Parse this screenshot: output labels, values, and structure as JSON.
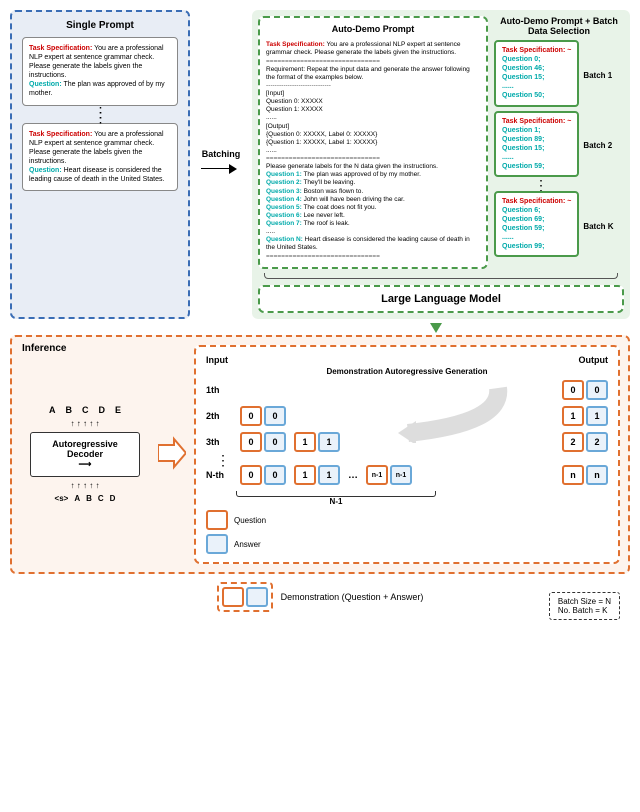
{
  "single_prompt": {
    "title": "Single Prompt",
    "card_a_task_label": "Task Specification:",
    "card_a_task_text": " You are a professional NLP expert at sentence grammar check. Please generate the labels given the instructions.",
    "card_a_q_label": "Question:",
    "card_a_q_text": " The plan was approved of by my mother.",
    "card_b_task_label": "Task Specification:",
    "card_b_task_text": " You are a professional NLP expert at sentence grammar check. Please generate the labels given the instructions.",
    "card_b_q_label": "Question:",
    "card_b_q_text": " Heart disease is considered the leading cause of death in the United States."
  },
  "batching_label": "Batching",
  "auto_demo": {
    "title": "Auto-Demo Prompt",
    "task_label": "Task Specification:",
    "task_text": " You are a professional NLP expert at sentence grammar check. Please generate the labels given the instructions.",
    "sep1": "==============================",
    "req": "Requirement: Repeat the input data and generate the answer following the format of the examples below.",
    "sep2": "------------------------------",
    "input_hdr": "[Input]",
    "in0": "Question 0:  XXXXX",
    "in1": "Question 1:  XXXXX",
    "dots1": "......",
    "output_hdr": "[Output]",
    "out0": "{Question 0: XXXXX, Label 0: XXXXX}",
    "out1": "{Question 1: XXXXX, Label 1: XXXXX}",
    "dots2": "......",
    "sep3": "==============================",
    "instr": "Please generate labels for the N data given the instructions.",
    "q1l": "Question 1:",
    "q1t": " The plan was approved of by my mother.",
    "q2l": "Question 2:",
    "q2t": " They'll be leaving.",
    "q3l": "Question 3:",
    "q3t": " Boston was flown to.",
    "q4l": "Question 4:",
    "q4t": " John will have been driving the car.",
    "q5l": "Question 5:",
    "q5t": " The coat does not fit you.",
    "q6l": "Question 6:",
    "q6t": " Lee never left.",
    "q7l": "Question 7:",
    "q7t": " The roof is leak.",
    "dots3": ".....",
    "qnl": "Question N:",
    "qnt": " Heart disease is considered the leading cause of death in the United States.",
    "sep4": "=============================="
  },
  "batch_sel": {
    "title": "Auto-Demo Prompt + Batch Data Selection",
    "task_label": "Task Specification: ~",
    "b1": [
      "Question 0;",
      "Question 46;",
      "Question 15;",
      "......",
      "Question 50;"
    ],
    "b2": [
      "Question 1;",
      "Question 89;",
      "Question 15;",
      "......",
      "Question 59;"
    ],
    "bk": [
      "Question 6;",
      "Question 69;",
      "Question 59;",
      "......",
      "Question 99;"
    ],
    "tag1": "Batch 1",
    "tag2": "Batch 2",
    "tagk": "Batch K"
  },
  "llm": "Large Language Model",
  "inference": {
    "title": "Inference",
    "letters_top": [
      "A",
      "B",
      "C",
      "D",
      "E"
    ],
    "letters_bot": [
      "<s>",
      "A",
      "B",
      "C",
      "D"
    ],
    "decoder": "Autoregressive Decoder",
    "input": "Input",
    "output": "Output",
    "sub": "Demonstration Autoregressive Generation",
    "rows": [
      "1th",
      "2th",
      "3th",
      "N-th"
    ],
    "n_minus_1": "N-1",
    "legend_q": "Question",
    "legend_a": "Answer",
    "demo_legend": "Demonstration (Question + Answer)",
    "footer1": "Batch Size = N",
    "footer2": "No. Batch = K"
  }
}
